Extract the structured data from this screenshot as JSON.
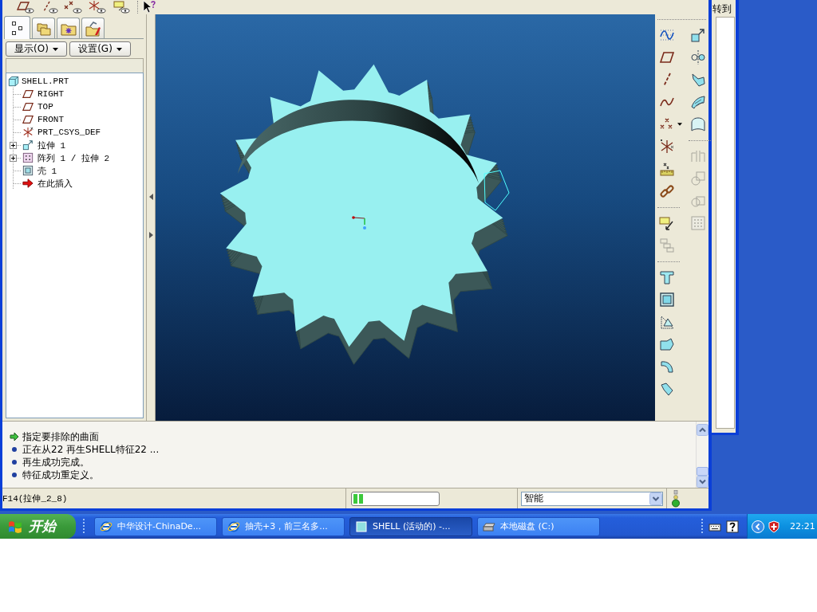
{
  "model_tree": {
    "tabs": [
      {
        "selected": true
      },
      {
        "selected": false
      },
      {
        "selected": false
      },
      {
        "selected": false
      }
    ],
    "menus": [
      {
        "label": "显示(O)"
      },
      {
        "label": "设置(G)"
      }
    ],
    "items": [
      {
        "label": "SHELL.PRT",
        "kind": "part",
        "children": [
          {
            "label": "RIGHT",
            "kind": "plane"
          },
          {
            "label": "TOP",
            "kind": "plane"
          },
          {
            "label": "FRONT",
            "kind": "plane"
          },
          {
            "label": "PRT_CSYS_DEF",
            "kind": "csys"
          },
          {
            "label": "拉伸 1",
            "kind": "extrude",
            "expanded": false
          },
          {
            "label": "阵列 1 / 拉伸 2",
            "kind": "pattern",
            "expanded": false
          },
          {
            "label": "壳 1",
            "kind": "shell"
          },
          {
            "label": "在此插入",
            "kind": "insert"
          }
        ]
      }
    ]
  },
  "feature_toolbar": {
    "column_1": [
      {
        "disabled": false
      },
      {
        "disabled": false
      },
      {
        "disabled": false
      },
      {
        "disabled": false
      },
      {
        "disabled": false
      },
      {
        "disabled": false
      },
      {
        "disabled": false
      },
      {
        "disabled": false
      },
      {
        "disabled": false
      },
      {
        "disabled": true
      },
      {
        "disabled": false
      },
      {
        "disabled": false
      },
      {
        "disabled": false
      },
      {
        "disabled": false
      },
      {
        "disabled": false
      },
      {
        "disabled": false
      }
    ],
    "column_2": [
      {
        "disabled": false
      },
      {
        "disabled": false
      },
      {
        "disabled": false
      },
      {
        "disabled": false
      },
      {
        "disabled": false
      },
      {
        "disabled": true
      },
      {
        "disabled": true
      },
      {
        "disabled": true
      },
      {
        "disabled": true
      }
    ]
  },
  "messages": [
    {
      "kind": "prompt",
      "text": "指定要排除的曲面"
    },
    {
      "kind": "info",
      "text": "正在从22 再生SHELL特征22 ..."
    },
    {
      "kind": "info",
      "text": "再生成功完成。"
    },
    {
      "kind": "info",
      "text": "特征成功重定义。"
    }
  ],
  "status_bar": {
    "selection": "F14(拉伸_2_8)",
    "progress": {
      "level": 0.13
    },
    "filter": {
      "value": "智能"
    }
  },
  "browser_window": {
    "go_button": "转到"
  },
  "taskbar": {
    "start": "开始",
    "tasks": [
      {
        "label": "中华设计-ChinaDe...",
        "selected": false
      },
      {
        "label": "抽壳+3，前三名多...",
        "selected": false
      },
      {
        "label": "SHELL (活动的) -...",
        "selected": true
      },
      {
        "label": "本地磁盘 (C:)",
        "selected": false
      }
    ],
    "clock": "22:21"
  }
}
